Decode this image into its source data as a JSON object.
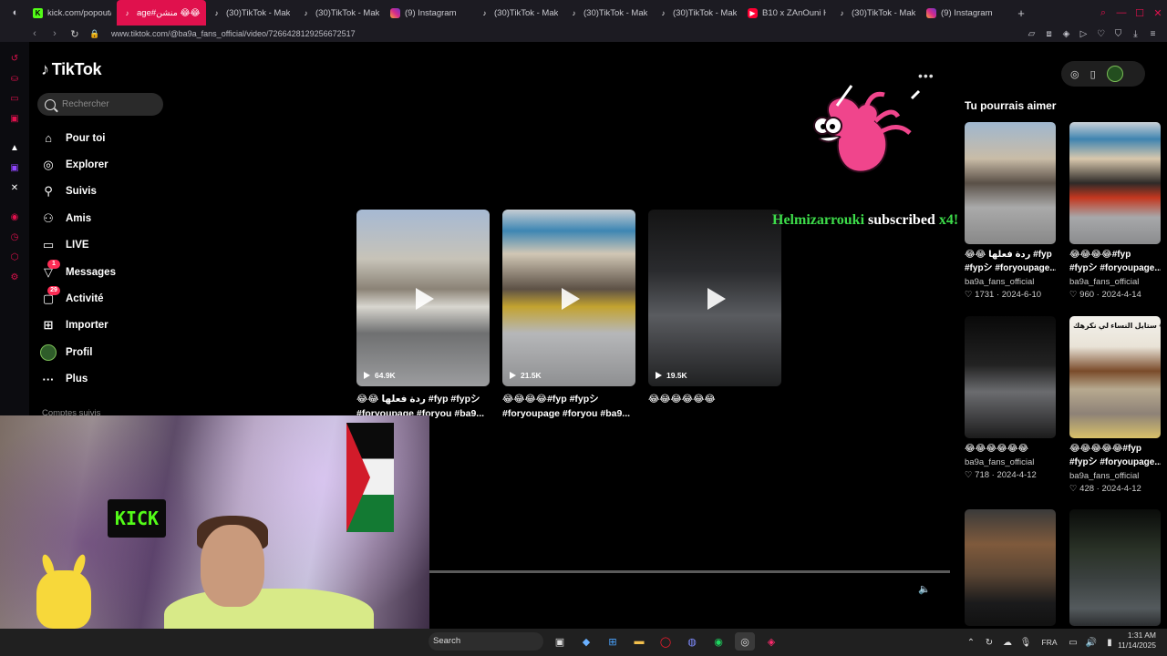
{
  "browser": {
    "tabs": [
      {
        "label": "kick.com/popout/",
        "icon": "kick-icon",
        "active": false
      },
      {
        "label": "age#منشن 😂😂😂😂",
        "icon": "tiktok-icon",
        "active": true
      },
      {
        "label": "(30)TikTok - Make",
        "icon": "tiktok-icon",
        "active": false
      },
      {
        "label": "(30)TikTok - Make",
        "icon": "tiktok-icon",
        "active": false
      },
      {
        "label": "(9) Instagram",
        "icon": "instagram-icon",
        "active": false
      },
      {
        "label": "(30)TikTok - Make",
        "icon": "tiktok-icon",
        "active": false
      },
      {
        "label": "(30)TikTok - Make",
        "icon": "tiktok-icon",
        "active": false
      },
      {
        "label": "(30)TikTok - Make",
        "icon": "tiktok-icon",
        "active": false
      },
      {
        "label": "B10 x ZAnOuni H",
        "icon": "youtube-icon",
        "active": false
      },
      {
        "label": "(30)TikTok - Make",
        "icon": "tiktok-icon",
        "active": false
      },
      {
        "label": "(9) Instagram",
        "icon": "instagram-icon",
        "active": false
      }
    ],
    "new_tab": "+",
    "url": "www.tiktok.com/@ba9a_fans_official/video/7266428129256672517"
  },
  "tiktok": {
    "logo": "TikTok",
    "search_placeholder": "Rechercher",
    "menu": [
      {
        "label": "Pour toi",
        "icon": "home-icon",
        "badge": ""
      },
      {
        "label": "Explorer",
        "icon": "compass-icon",
        "badge": ""
      },
      {
        "label": "Suivis",
        "icon": "following-icon",
        "badge": ""
      },
      {
        "label": "Amis",
        "icon": "friends-icon",
        "badge": ""
      },
      {
        "label": "LIVE",
        "icon": "live-icon",
        "badge": ""
      },
      {
        "label": "Messages",
        "icon": "messages-icon",
        "badge": "1"
      },
      {
        "label": "Activité",
        "icon": "activity-icon",
        "badge": "29"
      },
      {
        "label": "Importer",
        "icon": "upload-icon",
        "badge": ""
      },
      {
        "label": "Profil",
        "icon": "profile-avatar",
        "badge": ""
      },
      {
        "label": "Plus",
        "icon": "more-icon",
        "badge": ""
      }
    ],
    "following_heading": "Comptes suivis",
    "feed": [
      {
        "views": "64.9K",
        "caption": "😂😂 ردة فعلها #fyp #fypシ #foryoupage #foryou #ba9..."
      },
      {
        "views": "21.5K",
        "caption": "😂😂😂😂#fyp #fypシ #foryoupage #foryou #ba9..."
      },
      {
        "views": "19.5K",
        "caption": "😂😂😂😂😂😂"
      }
    ],
    "more_menu": "•••",
    "recommend_title": "Tu pourrais aimer",
    "recommendations": [
      {
        "caption1": "😂😂 ردة فعلها #fyp",
        "caption2": "#fypシ #foryoupage...",
        "author": "ba9a_fans_official",
        "likes": "1731",
        "date": "2024-6-10"
      },
      {
        "caption1": "😂😂😂😂#fyp",
        "caption2": "#fypシ #foryoupage...",
        "author": "ba9a_fans_official",
        "likes": "960",
        "date": "2024-4-14"
      },
      {
        "caption1": "😂😂😂😂😂😂",
        "caption2": "",
        "author": "ba9a_fans_official",
        "likes": "718",
        "date": "2024-4-12"
      },
      {
        "caption1": "😂😂😂😂😂#fyp",
        "caption2": "#fypシ #foryoupage...",
        "author": "ba9a_fans_official",
        "likes": "428",
        "date": "2024-4-12",
        "overlay": "ستايل النساء لي نكرهك 😂😂😂"
      },
      {
        "caption1": "",
        "caption2": "",
        "author": "",
        "likes": "",
        "date": ""
      },
      {
        "caption1": "",
        "caption2": "",
        "author": "",
        "likes": "",
        "date": ""
      }
    ]
  },
  "stream": {
    "alert_name": "Helmizarrouki",
    "alert_middle": "subscribed",
    "alert_count": "x4!",
    "kick_sign": "KICK"
  },
  "taskbar": {
    "search": "Search",
    "lang": "FRA",
    "time": "1:31 AM",
    "date": "11/14/2025"
  },
  "colors": {
    "accent": "#e0114d",
    "kick_green": "#53fc18",
    "tiktok_red": "#fe2c55"
  }
}
